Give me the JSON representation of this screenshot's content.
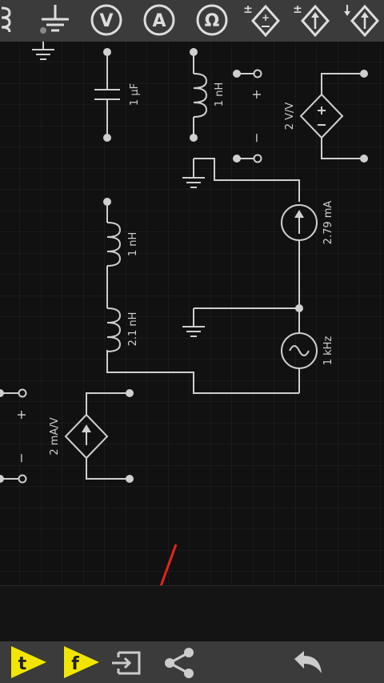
{
  "toolbar": {
    "items": [
      {
        "name": "inductor-tool",
        "icon": "inductor-icon"
      },
      {
        "name": "ground-tool",
        "icon": "ground-icon"
      },
      {
        "name": "voltmeter-tool",
        "icon": "voltmeter-icon",
        "label": "V"
      },
      {
        "name": "ammeter-tool",
        "icon": "ammeter-icon",
        "label": "A"
      },
      {
        "name": "ohmmeter-tool",
        "icon": "ohmmeter-icon",
        "label": "Ω"
      },
      {
        "name": "vcvs-tool",
        "icon": "dependent-voltage-source-icon"
      },
      {
        "name": "vccs-tool",
        "icon": "dependent-current-source-icon"
      },
      {
        "name": "cccs-tool",
        "icon": "dependent-current-source-down-icon"
      }
    ]
  },
  "circuit": {
    "capacitor_label": "1 µF",
    "inductor_top_label": "1 nH",
    "inductor_mid_label": "1 nH",
    "inductor_low_label": "2.1 nH",
    "vcvs_label": "2 V/V",
    "current_source_label": "2.79 mA",
    "ac_source_label": "1 kHz",
    "vccs_label": "2 mA/V",
    "plus_sign": "+",
    "minus_sign": "−"
  },
  "colors": {
    "toolbar_bg": "#3b3b3b",
    "canvas_bg": "#111111",
    "grid": "#2a2a2a",
    "wire": "#cfcfcf",
    "accent_yellow": "#f2e600",
    "annotation_red": "#e8231d"
  },
  "bottom_bar": {
    "time_button_label": "t",
    "frequency_button_label": "f",
    "export_icon": "export-icon",
    "share_icon": "share-icon",
    "undo_icon": "undo-icon"
  }
}
